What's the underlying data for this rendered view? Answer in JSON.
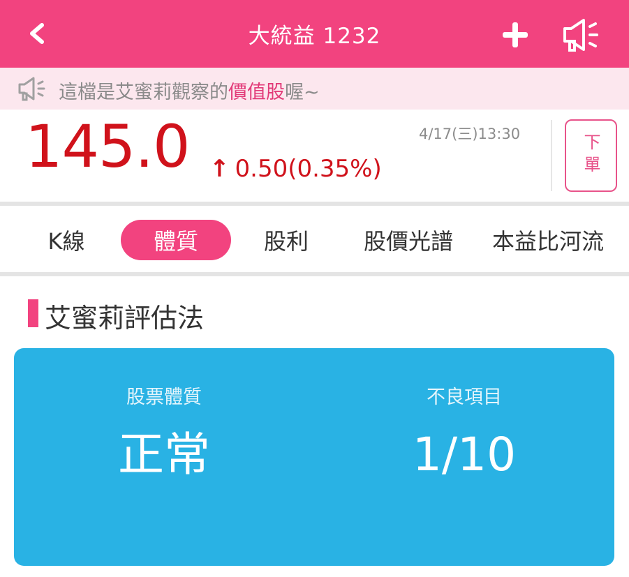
{
  "header": {
    "back_icon": "chevron-left-icon",
    "title": "大統益 1232",
    "add_icon": "plus-icon",
    "speaker_icon": "megaphone-icon",
    "bg_color": "#f2437f"
  },
  "notice": {
    "icon": "megaphone-icon",
    "text_before": "這檔是艾蜜莉觀察的",
    "text_highlight": "價值股",
    "text_after": "喔~"
  },
  "quote": {
    "price": "145.0",
    "change_arrow": "↑",
    "change": "0.50(0.35%)",
    "datetime": "4/17(三)13:30",
    "order_button": "下單",
    "up_color": "#d0121b"
  },
  "tabs": [
    {
      "label": "K線",
      "active": false
    },
    {
      "label": "體質",
      "active": true
    },
    {
      "label": "股利",
      "active": false
    },
    {
      "label": "股價光譜",
      "active": false
    },
    {
      "label": "本益比河流",
      "active": false
    }
  ],
  "section": {
    "title": "艾蜜莉評估法"
  },
  "card": {
    "left_label": "股票體質",
    "left_value": "正常",
    "right_label": "不良項目",
    "right_value": "1/10",
    "bg_color": "#29b2e4"
  }
}
